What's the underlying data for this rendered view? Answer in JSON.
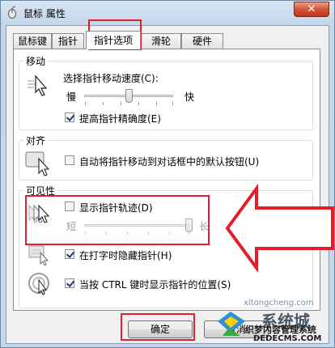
{
  "window": {
    "title": "鼠标 属性",
    "close_label": "✕"
  },
  "tabs": [
    {
      "label": "鼠标键"
    },
    {
      "label": "指针"
    },
    {
      "label": "指针选项"
    },
    {
      "label": "滑轮"
    },
    {
      "label": "硬件"
    }
  ],
  "active_tab": "指针选项",
  "motion": {
    "group_label": "移动",
    "speed_label": "选择指针移动速度(C):",
    "slow_label": "慢",
    "fast_label": "快",
    "speed_level": 0.5,
    "precision_label": "提高指针精确度(E)",
    "precision_checked": true
  },
  "snap": {
    "group_label": "对齐",
    "snap_label": "自动将指针移动到对话框中的默认按钮(U)",
    "snap_checked": false
  },
  "visibility": {
    "group_label": "可见性",
    "trails_label": "显示指针轨迹(D)",
    "trails_checked": false,
    "short_label": "短",
    "long_label": "长",
    "trails_level": 1.0,
    "hide_label": "在打字时隐藏指针(H)",
    "hide_checked": true,
    "ctrl_label": "当按 CTRL 键时显示指针的位置(S)",
    "ctrl_checked": true
  },
  "buttons": {
    "ok_label": "确定",
    "cancel_label": "取消"
  },
  "watermark": {
    "domain_top": "xitongcheng.com",
    "brand": "系统城",
    "line1": "织梦内容管理系统",
    "line2": "DEDECMS.COM"
  },
  "colors": {
    "annotation_red": "#e0202a",
    "accent": "#1e3e7a"
  }
}
